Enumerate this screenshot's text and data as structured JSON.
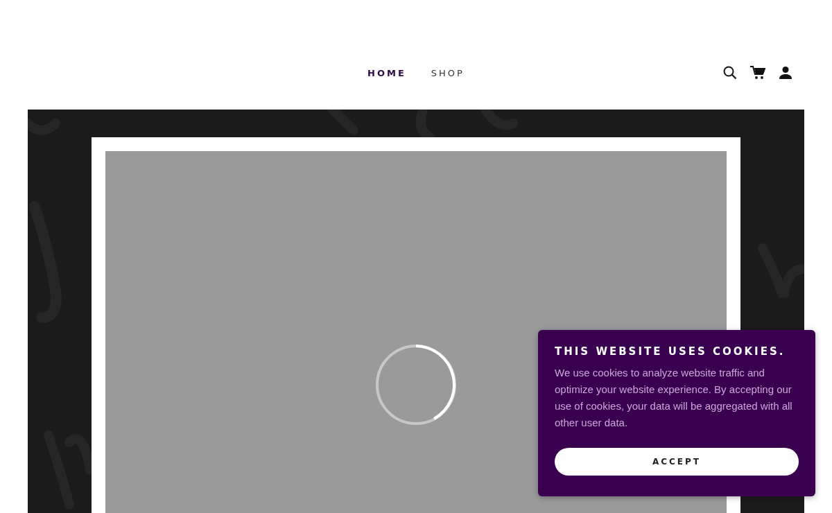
{
  "nav": {
    "items": [
      {
        "label": "HOME",
        "selected": true
      },
      {
        "label": "SHOP",
        "selected": false
      }
    ]
  },
  "hero": {
    "loading": true
  },
  "cookie_banner": {
    "title": "THIS WEBSITE USES COOKIES.",
    "text": "We use cookies to analyze website traffic and optimize your website experience. By accepting our use of cookies, your data will be aggregated with all other user data.",
    "button": "ACCEPT"
  }
}
